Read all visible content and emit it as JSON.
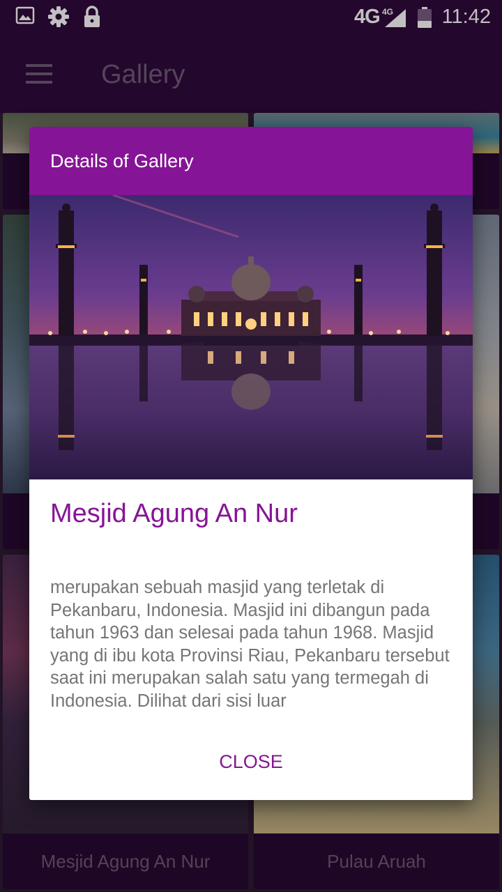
{
  "status_bar": {
    "network": "4G",
    "network_sup": "4G",
    "time": "11:42",
    "icons": [
      "image-icon",
      "gear-icon",
      "lock-icon",
      "signal-icon",
      "battery-icon"
    ]
  },
  "app_bar": {
    "title": "Gallery"
  },
  "grid": {
    "tiles": [
      {
        "caption": "Mesjid Agung An Nur"
      },
      {
        "caption": "Pulau Aruah"
      }
    ]
  },
  "dialog": {
    "header_title": "Details of Gallery",
    "place_name": "Mesjid Agung An Nur",
    "description": "merupakan sebuah masjid yang terletak di Pekanbaru, Indonesia. Masjid ini dibangun pada tahun 1963 dan selesai pada tahun 1968. Masjid yang di ibu kota Provinsi Riau, Pekanbaru tersebut saat ini merupakan salah satu yang termegah di Indonesia. Dilihat dari sisi luar",
    "close_label": "CLOSE"
  },
  "colors": {
    "primary_dark": "#2d0a36",
    "accent": "#861496"
  }
}
